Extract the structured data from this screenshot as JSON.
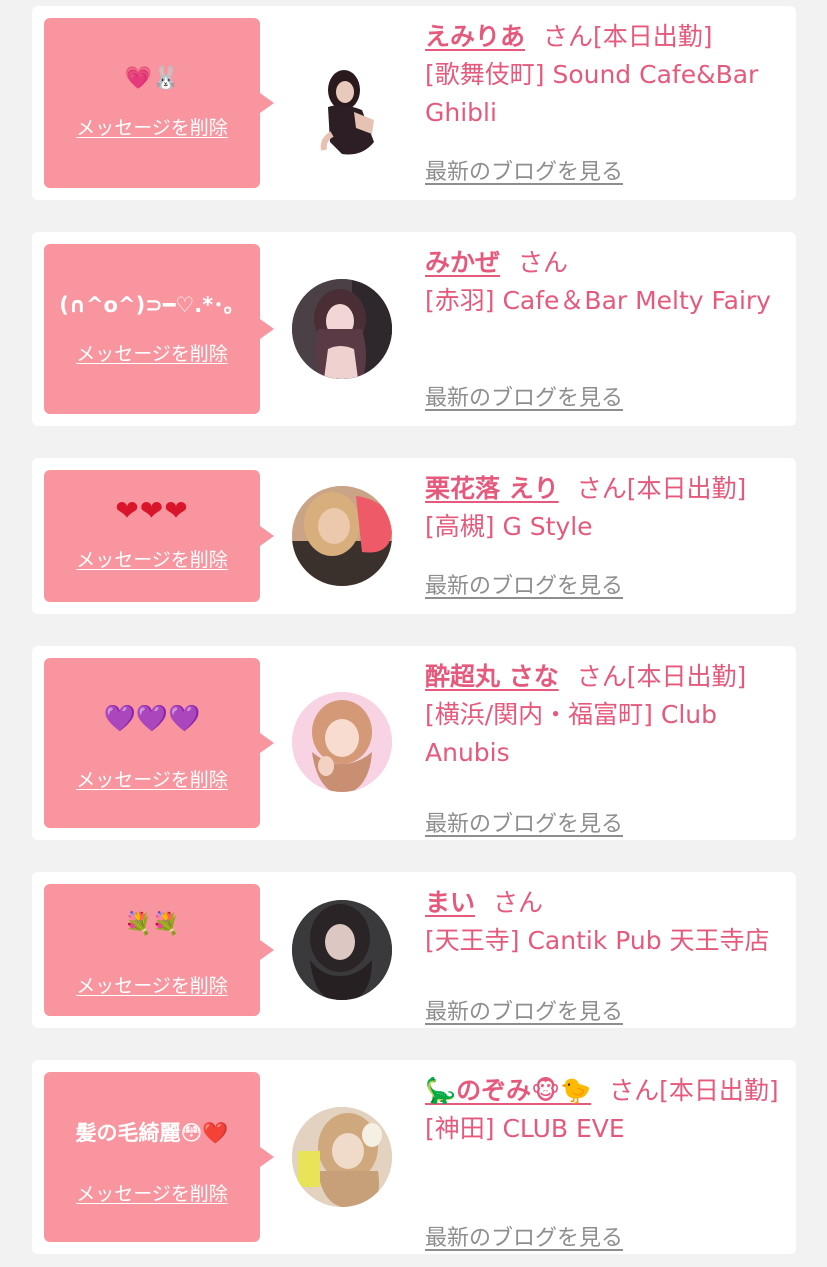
{
  "colors": {
    "accent": "#e55a7c",
    "bubble": "#f8959f",
    "link_gray": "#8e8e8e",
    "background": "#f2f2f2"
  },
  "labels": {
    "delete": "メッセージを削除",
    "blog": "最新のブログを見る",
    "san": "さん"
  },
  "cards": [
    {
      "message": "💗🐰",
      "name": "えみりあ",
      "suffix": "さん[本日出勤]",
      "shop": "[歌舞伎町] Sound Cafe&Bar Ghibli"
    },
    {
      "message": "(∩^o^)⊃━♡.*･。",
      "name": "みかぜ",
      "suffix": "さん",
      "shop": "[赤羽] Cafe＆Bar Melty Fairy"
    },
    {
      "message": "❤❤❤",
      "name": "栗花落 えり",
      "suffix": "さん[本日出勤]",
      "shop": "[高槻] G Style"
    },
    {
      "message": "💜💜💜",
      "name": "酔超丸 さな",
      "suffix": "さん[本日出勤]",
      "shop": "[横浜/関内・福富町] Club Anubis"
    },
    {
      "message": "💐💐",
      "name": "まい",
      "suffix": "さん",
      "shop": "[天王寺] Cantik Pub 天王寺店"
    },
    {
      "message": "髪の毛綺麗😳❤️",
      "name": "🦕のぞみ🐵🐤",
      "suffix": "さん[本日出勤]",
      "shop": "[神田] CLUB EVE"
    }
  ]
}
